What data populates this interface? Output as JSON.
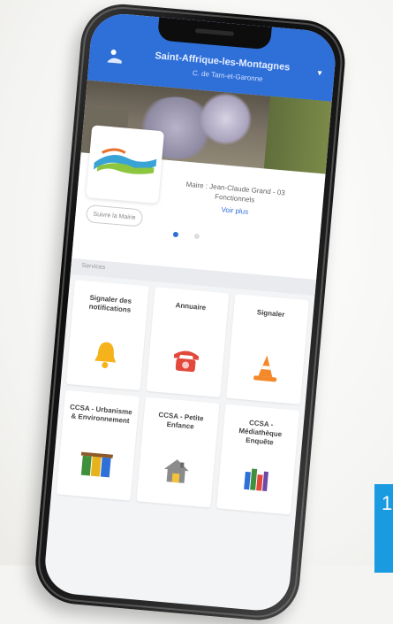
{
  "app": {
    "commune_name": "Saint-Affrique-les-Montagnes",
    "header_subtitle": "C. de Tarn-et-Garonne",
    "brand_color": "#2f6fd8"
  },
  "profile": {
    "mayor_text": "Maire : Jean-Claude Grand - 03 Fonctionnels",
    "view_link": "Voir plus",
    "follow_label": "Suivre la Mairie"
  },
  "carousel": {
    "dot_count": 2,
    "active_index": 0
  },
  "section": {
    "label": "Services"
  },
  "tiles": [
    {
      "label": "Signaler des notifications",
      "icon": "bell-icon"
    },
    {
      "label": "Annuaire",
      "icon": "phone-icon"
    },
    {
      "label": "Signaler",
      "icon": "traffic-cone-icon"
    },
    {
      "label": "CCSA - Urbanisme & Environnement",
      "icon": "recycling-bins-icon"
    },
    {
      "label": "CCSA - Petite Enfance",
      "icon": "house-icon"
    },
    {
      "label": "CCSA - Médiathèque Enquête",
      "icon": "library-icon"
    }
  ],
  "badge": {
    "text": "1"
  }
}
